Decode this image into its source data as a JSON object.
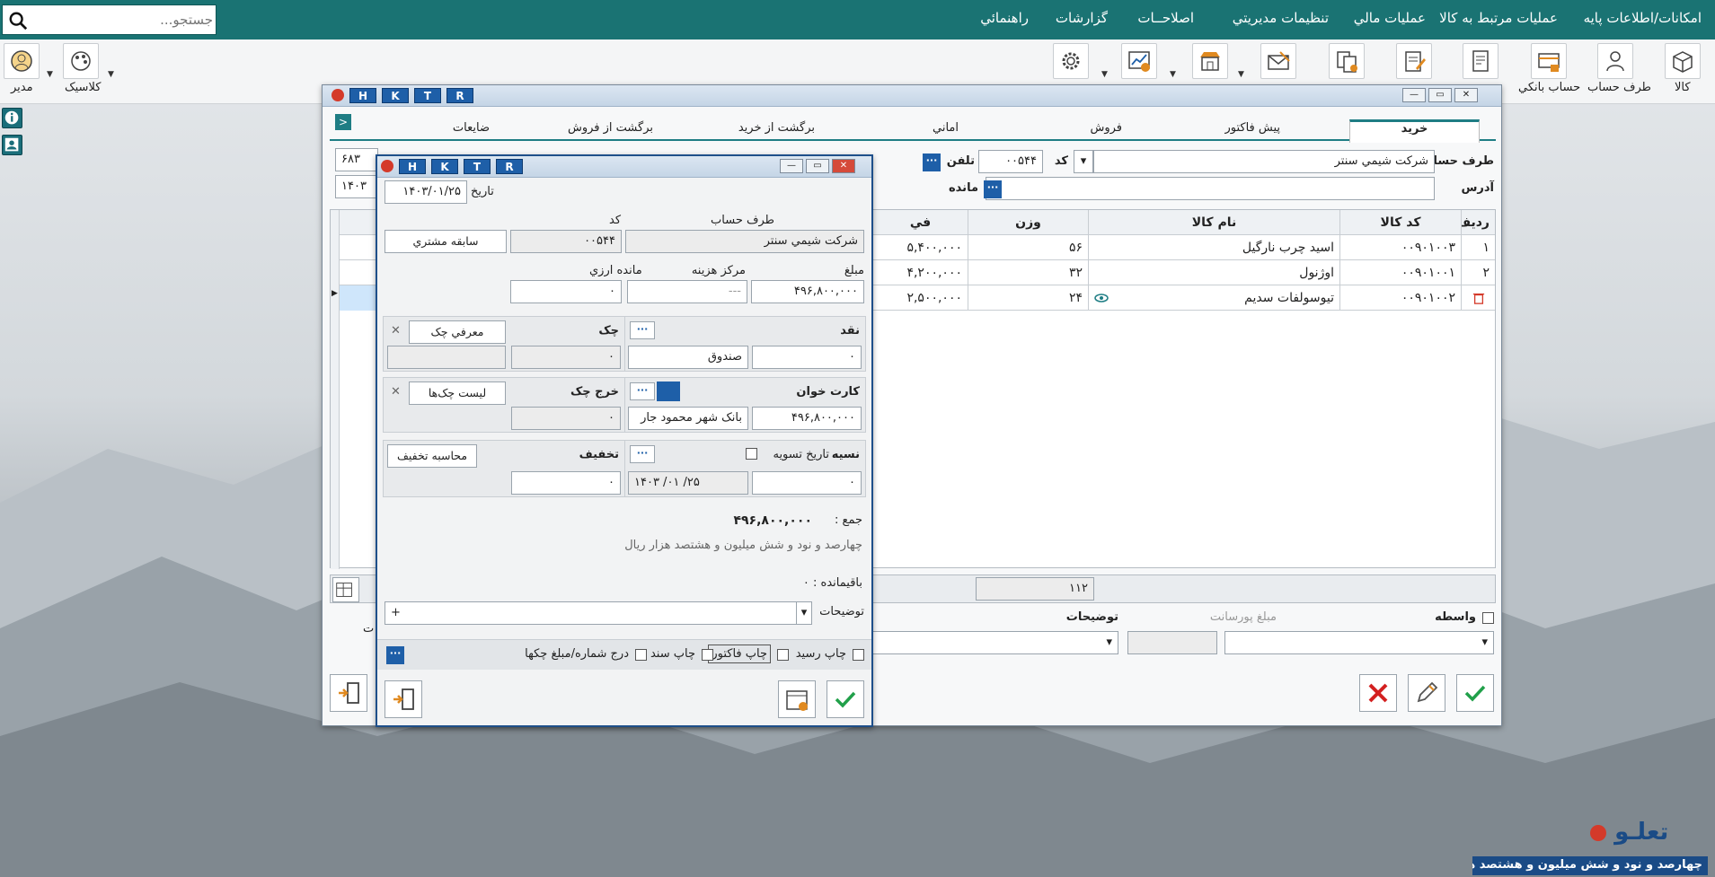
{
  "menu": {
    "items": [
      "امکانات/اطلاعات پایه",
      "عملیات مرتبط به کالا",
      "عملیات مالي",
      "تنظیمات مدیریتي",
      "اصلاحــات",
      "گزارشات",
      "راهنمائي"
    ],
    "search_placeholder": "جستجو..."
  },
  "toolbar": {
    "labels": [
      "کالا",
      "طرف حساب",
      "حساب بانکي",
      "کلاسیک",
      "مدیر"
    ],
    "icons": [
      "box-icon",
      "person-card-icon",
      "bank-card-icon",
      "invoice-icon",
      "doc-edit-icon",
      "doc-copy-icon",
      "letter-icon",
      "store-icon",
      "chart-icon",
      "gear-icon",
      "palette-icon",
      "user-avatar-icon"
    ]
  },
  "main_window": {
    "hk": [
      "H",
      "K",
      "T",
      "R"
    ],
    "tabs": [
      "خرید",
      "پیش فاکتور",
      "فروش",
      "اماني",
      "برگشت از خرید",
      "برگشت از فروش",
      "ضایعات"
    ],
    "account_label": "طرف حساب",
    "account_value": "شرکت شیمي سنتر",
    "code_label": "کد",
    "code_value": "۰۰۵۴۴",
    "phone_label": "تلفن",
    "address_label": "آدرس",
    "remain_label": "مانده",
    "left_value_1": "۶۸۳",
    "left_value_2": "۱۴۰۳",
    "columns": [
      "ردیف",
      "کد کالا",
      "نام کالا",
      "وزن",
      "في"
    ],
    "rows": [
      {
        "idx": "۱",
        "code": "۰۰۹۰۱۰۰۳",
        "name": "اسید چرب نارگیل",
        "weight": "۵۶",
        "price": "۵,۴۰۰,۰۰۰"
      },
      {
        "idx": "۲",
        "code": "۰۰۹۰۱۰۰۱",
        "name": "اوژنول",
        "weight": "۳۲",
        "price": "۴,۲۰۰,۰۰۰"
      },
      {
        "idx": "",
        "code": "۰۰۹۰۱۰۰۲",
        "name": "تیوسولفات سدیم",
        "weight": "۲۴",
        "price": "۲,۵۰۰,۰۰۰"
      }
    ],
    "total_weight": "۱۱۲",
    "broker_label": "واسطه",
    "commission_label": "مبلغ پورسانت",
    "notes_label": "توضیحات",
    "partial_label": "ت"
  },
  "payment_dialog": {
    "hk": [
      "H",
      "K",
      "T",
      "R"
    ],
    "date_label": "تاریخ",
    "date_value": "۱۴۰۳/۰۱/۲۵",
    "account_label": "طرف حساب",
    "code_label": "کد",
    "account_value": "شرکت شیمي سنتر",
    "code_value": "۰۰۵۴۴",
    "history_button": "سابقه مشتري",
    "amount_label": "مبلغ",
    "amount_value": "۴۹۶,۸۰۰,۰۰۰",
    "cost_center_label": "مرکز هزینه",
    "cost_center_value": "---",
    "fx_remain_label": "مانده ارزي",
    "fx_remain_value": "۰",
    "cash_label": "نقد",
    "cash_value": "۰",
    "cash_box": "صندوق",
    "cheque_label": "چک",
    "cheque_value": "۰",
    "introduce_cheque": "معرفي چک",
    "card_label": "کارت خوان",
    "card_value": "۴۹۶,۸۰۰,۰۰۰",
    "card_bank": "بانک شهر محمود جار",
    "spend_cheque_label": "خرج چک",
    "spend_cheque_value": "۰",
    "cheque_list": "لیست چک‌ها",
    "credit_label": "نسیه",
    "credit_value": "۰",
    "settle_date_label": "تاریخ تسویه",
    "settle_date_value": "۱۴۰۳ /۰۱ /۲۵",
    "discount_label": "تخفیف",
    "discount_value": "۰",
    "calc_discount": "محاسبه تخفیف",
    "sum_label": "جمع :",
    "sum_value": "۴۹۶,۸۰۰,۰۰۰",
    "sum_words": "چهارصد و نود و شش میلیون  و  هشتصد هزار  ریال",
    "remaining_label": "باقیمانده : ۰",
    "notes_label": "توضیحات",
    "notes_add": "+",
    "print_receipt": "چاپ رسید",
    "print_invoice": "چاپ فاکتور",
    "print_doc": "چاپ سند",
    "insert_cheque_no": "درج شماره/مبلغ چکها"
  },
  "status_text": "چهارصد و نود و شش میلیون  و  هشتصد هزار  ریال",
  "brand": "تعلـو"
}
